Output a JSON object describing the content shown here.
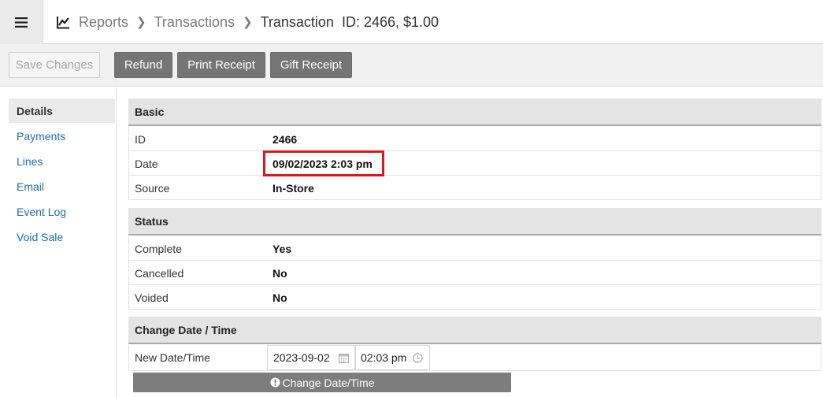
{
  "header": {
    "menu_icon": "hamburger-menu-icon",
    "reports_icon": "line-chart-icon",
    "breadcrumb": {
      "reports": "Reports",
      "transactions": "Transactions",
      "current": "Transaction  ID: 2466, $1.00"
    }
  },
  "toolbar": {
    "save_label": "Save Changes",
    "refund_label": "Refund",
    "print_label": "Print Receipt",
    "gift_label": "Gift Receipt"
  },
  "sidebar": {
    "items": [
      {
        "label": "Details",
        "active": true
      },
      {
        "label": "Payments",
        "active": false
      },
      {
        "label": "Lines",
        "active": false
      },
      {
        "label": "Email",
        "active": false
      },
      {
        "label": "Event Log",
        "active": false
      },
      {
        "label": "Void Sale",
        "active": false
      }
    ]
  },
  "basic": {
    "title": "Basic",
    "rows": [
      {
        "label": "ID",
        "value": "2466"
      },
      {
        "label": "Date",
        "value": "09/02/2023 2:03 pm"
      },
      {
        "label": "Source",
        "value": "In-Store"
      }
    ]
  },
  "status": {
    "title": "Status",
    "rows": [
      {
        "label": "Complete",
        "value": "Yes"
      },
      {
        "label": "Cancelled",
        "value": "No"
      },
      {
        "label": "Voided",
        "value": "No"
      }
    ]
  },
  "change": {
    "title": "Change Date / Time",
    "label": "New Date/Time",
    "date_value": "2023-09-02",
    "time_value": "02:03 pm",
    "button_label": "Change Date/Time"
  },
  "colors": {
    "highlight": "#e0141e",
    "link": "#1f6fa8",
    "button_dark": "#757575"
  }
}
